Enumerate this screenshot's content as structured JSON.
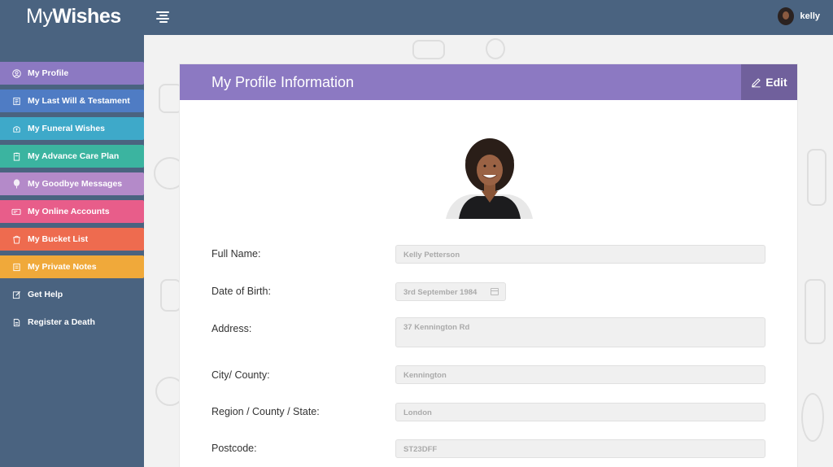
{
  "app": {
    "logo_light": "My",
    "logo_bold": "Wishes",
    "username": "kelly"
  },
  "sidebar": {
    "items": [
      {
        "label": "My Profile",
        "color": "#8c79c2",
        "icon": "user-circle-icon"
      },
      {
        "label": "My Last Will & Testament",
        "color": "#4f7cc4",
        "icon": "scroll-icon"
      },
      {
        "label": "My Funeral Wishes",
        "color": "#3ea9c9",
        "icon": "funeral-icon"
      },
      {
        "label": "My Advance Care Plan",
        "color": "#3bb4a0",
        "icon": "clipboard-icon"
      },
      {
        "label": "My Goodbye Messages",
        "color": "#b48ac9",
        "icon": "balloon-icon"
      },
      {
        "label": "My Online Accounts",
        "color": "#e85d8a",
        "icon": "accounts-icon"
      },
      {
        "label": "My Bucket List",
        "color": "#ee6b4f",
        "icon": "bucket-icon"
      },
      {
        "label": "My Private Notes",
        "color": "#f0a93a",
        "icon": "notes-icon"
      },
      {
        "label": "Get Help",
        "color": "",
        "icon": "edit-square-icon"
      },
      {
        "label": "Register a Death",
        "color": "",
        "icon": "document-icon"
      }
    ]
  },
  "card": {
    "title": "My Profile Information",
    "edit_label": "Edit"
  },
  "form": {
    "full_name_label": "Full Name:",
    "full_name_value": "Kelly Petterson",
    "dob_label": "Date of Birth:",
    "dob_value": "3rd September 1984",
    "address_label": "Address:",
    "address_value": "37 Kennington Rd",
    "city_label": "City/ County:",
    "city_value": "Kennington",
    "region_label": "Region / County / State:",
    "region_value": "London",
    "postcode_label": "Postcode:",
    "postcode_value": "ST23DFF"
  }
}
